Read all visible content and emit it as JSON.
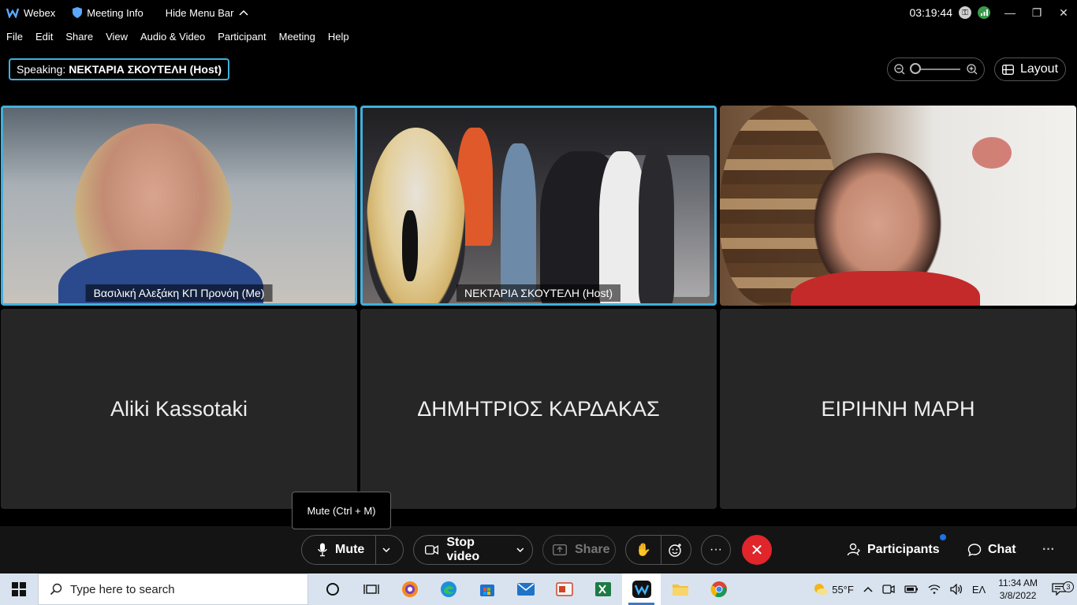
{
  "titlebar": {
    "app_name": "Webex",
    "meeting_info": "Meeting Info",
    "hide_menu_bar": "Hide Menu Bar",
    "timer": "03:19:44"
  },
  "menu": [
    "File",
    "Edit",
    "Share",
    "View",
    "Audio & Video",
    "Participant",
    "Meeting",
    "Help"
  ],
  "speaking": {
    "prefix": "Speaking:",
    "name": "ΝΕΚΤΑΡΙΑ ΣΚΟΥΤΕΛΗ (Host)"
  },
  "layout_label": "Layout",
  "tiles": [
    {
      "label": "Βασιλική Αλεξάκη ΚΠ Προνόη  (Me)"
    },
    {
      "label": "ΝΕΚΤΑΡΙΑ ΣΚΟΥΤΕΛΗ  (Host)"
    },
    {
      "label": ""
    },
    {
      "label": "Aliki Kassotaki"
    },
    {
      "label": "ΔΗΜΗΤΡΙΟΣ ΚΑΡΔΑΚΑΣ"
    },
    {
      "label": "ΕΙΡΙΗΝΗ ΜΑΡΗ"
    }
  ],
  "tooltip": "Mute (Ctrl + M)",
  "controls": {
    "mute": "Mute",
    "stop_video": "Stop video",
    "share": "Share",
    "participants": "Participants",
    "chat": "Chat"
  },
  "taskbar": {
    "search_placeholder": "Type here to search",
    "weather": "55°F",
    "language": "ΕΛ",
    "time": "11:34 AM",
    "date": "3/8/2022",
    "notifications": "3"
  },
  "colors": {
    "accent": "#41b0dd",
    "end_call": "#e0252b"
  }
}
